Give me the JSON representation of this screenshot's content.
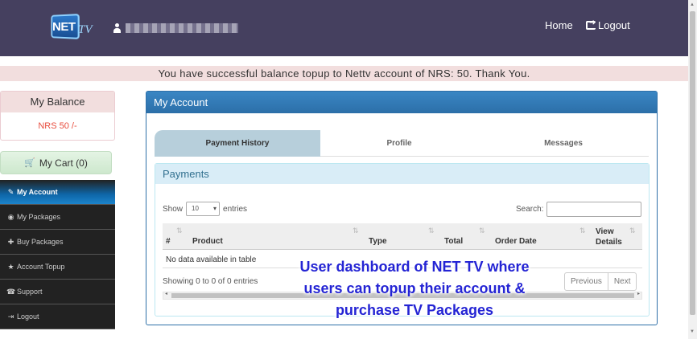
{
  "brand": {
    "logo_net": "NET",
    "logo_tv": "TV"
  },
  "header": {
    "home_label": "Home",
    "logout_label": "Logout"
  },
  "alert": {
    "message": "You have successful balance topup to Nettv account of NRS: 50. Thank You."
  },
  "balance": {
    "title": "My Balance",
    "value": "NRS 50 /-"
  },
  "cart": {
    "label": "My Cart (0)"
  },
  "sidebar": {
    "items": [
      {
        "label": "My Account",
        "icon": "edit-icon",
        "active": true
      },
      {
        "label": "My Packages",
        "icon": "eye-icon",
        "active": false
      },
      {
        "label": "Buy Packages",
        "icon": "plus-icon",
        "active": false
      },
      {
        "label": "Account Topup",
        "icon": "star-icon",
        "active": false
      },
      {
        "label": "Support",
        "icon": "phone-icon",
        "active": false
      },
      {
        "label": "Logout",
        "icon": "logout-icon",
        "active": false
      }
    ]
  },
  "panel": {
    "title": "My Account",
    "tabs": [
      {
        "label": "Payment History",
        "active": true
      },
      {
        "label": "Profile",
        "active": false
      },
      {
        "label": "Messages",
        "active": false
      }
    ],
    "payments": {
      "title": "Payments",
      "show_label": "Show",
      "entries_value": "10",
      "entries_label": "entries",
      "search_label": "Search:",
      "search_value": "",
      "columns": [
        "#",
        "Product",
        "Type",
        "Total",
        "Order Date",
        "View Details"
      ],
      "empty_message": "No data available in table",
      "info": "Showing 0 to 0 of 0 entries",
      "prev_label": "Previous",
      "next_label": "Next"
    }
  },
  "overlay_caption": "User dashboard of NET TV where users can topup their account & purchase TV Packages",
  "colors": {
    "header_bg": "#45405f",
    "alert_bg": "#f2dede",
    "balance_value": "#e84c3d",
    "panel_primary": "#2c6fa8",
    "caption": "#2424d4"
  }
}
